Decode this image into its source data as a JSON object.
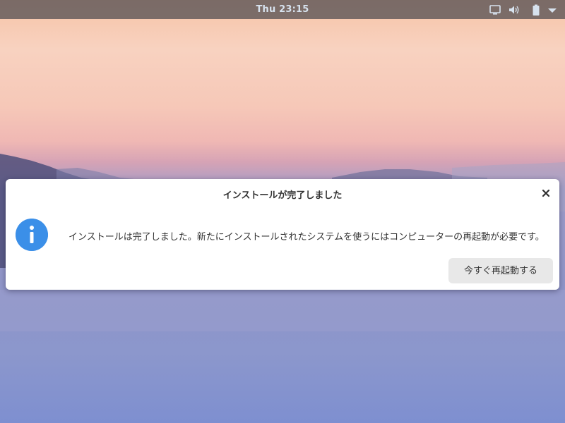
{
  "top_panel": {
    "clock": "Thu 23:15",
    "icons": [
      "display-icon",
      "volume-icon",
      "battery-icon",
      "menu-arrow-icon"
    ],
    "text_color": "#d7e2ee"
  },
  "dialog": {
    "title": "インストールが完了しました",
    "message": "インストールは完了しました。新たにインストールされたシステムを使うにはコンピューターの再起動が必要です。",
    "icon": "info-icon",
    "icon_color": "#3b8fe8",
    "close_icon": "close-icon",
    "restart_label": "今すぐ再起動する"
  },
  "wallpaper": {
    "description_colors": [
      "#f6c3a6",
      "#f0b8b4",
      "#9f9cc9",
      "#7e8fd0"
    ]
  }
}
